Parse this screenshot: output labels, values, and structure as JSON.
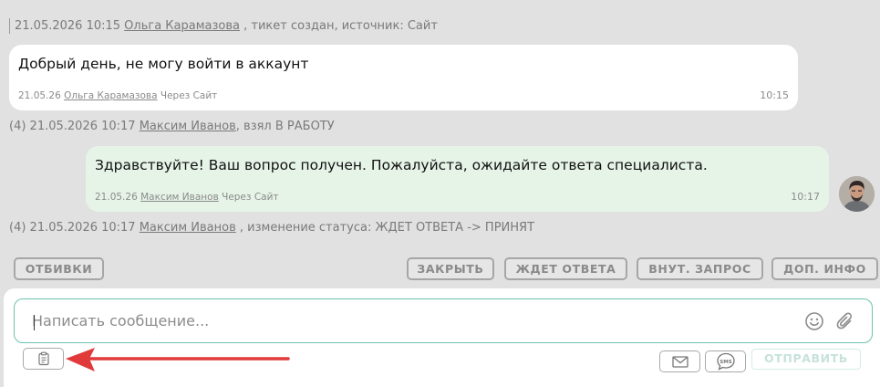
{
  "events": {
    "first": {
      "datetime": "21.05.2026 10:15",
      "user": "Ольга Карамазова",
      "text": ", тикет создан, источник: Сайт"
    },
    "taken": {
      "prefix": "(4) 21.05.2026 10:17",
      "user": "Максим Иванов",
      "text": ", взял В РАБОТУ"
    },
    "status": {
      "prefix": "(4) 21.05.2026 10:17",
      "user": "Максим Иванов",
      "text": ", изменение статуса: ЖДЕТ ОТВЕТА -> ПРИНЯТ"
    }
  },
  "messages": [
    {
      "text": "Добрый день, не могу войти в аккаунт",
      "date": "21.05.26",
      "user": "Ольга Карамазова",
      "via": "Через Сайт",
      "time": "10:15"
    },
    {
      "text": "Здравствуйте! Ваш вопрос получен. Пожалуйста, ожидайте ответа специалиста.",
      "date": "21.05.26",
      "user": "Максим Иванов",
      "via": "Через Сайт",
      "time": "10:17"
    }
  ],
  "actions": {
    "otbivki": "ОТБИВКИ",
    "close": "ЗАКРЫТЬ",
    "waiting": "ЖДЕТ ОТВЕТА",
    "internal": "ВНУТ. ЗАПРОС",
    "extra_info": "ДОП. ИНФО"
  },
  "composer": {
    "placeholder": "Написать сообщение...",
    "send_label": "ОТПРАВИТЬ",
    "sms_label": "SMS"
  },
  "icons": {
    "emoji": "smile-icon",
    "attach": "paperclip-icon",
    "templates": "clipboard-icon",
    "email": "envelope-icon",
    "sms": "sms-bubble-icon",
    "annotation": "red-arrow"
  },
  "colors": {
    "background": "#e1e1e1",
    "incoming_bubble": "#ffffff",
    "outgoing_bubble": "#e6f4e8",
    "input_border": "#6cc2ad",
    "arrow": "#e03a3a"
  }
}
